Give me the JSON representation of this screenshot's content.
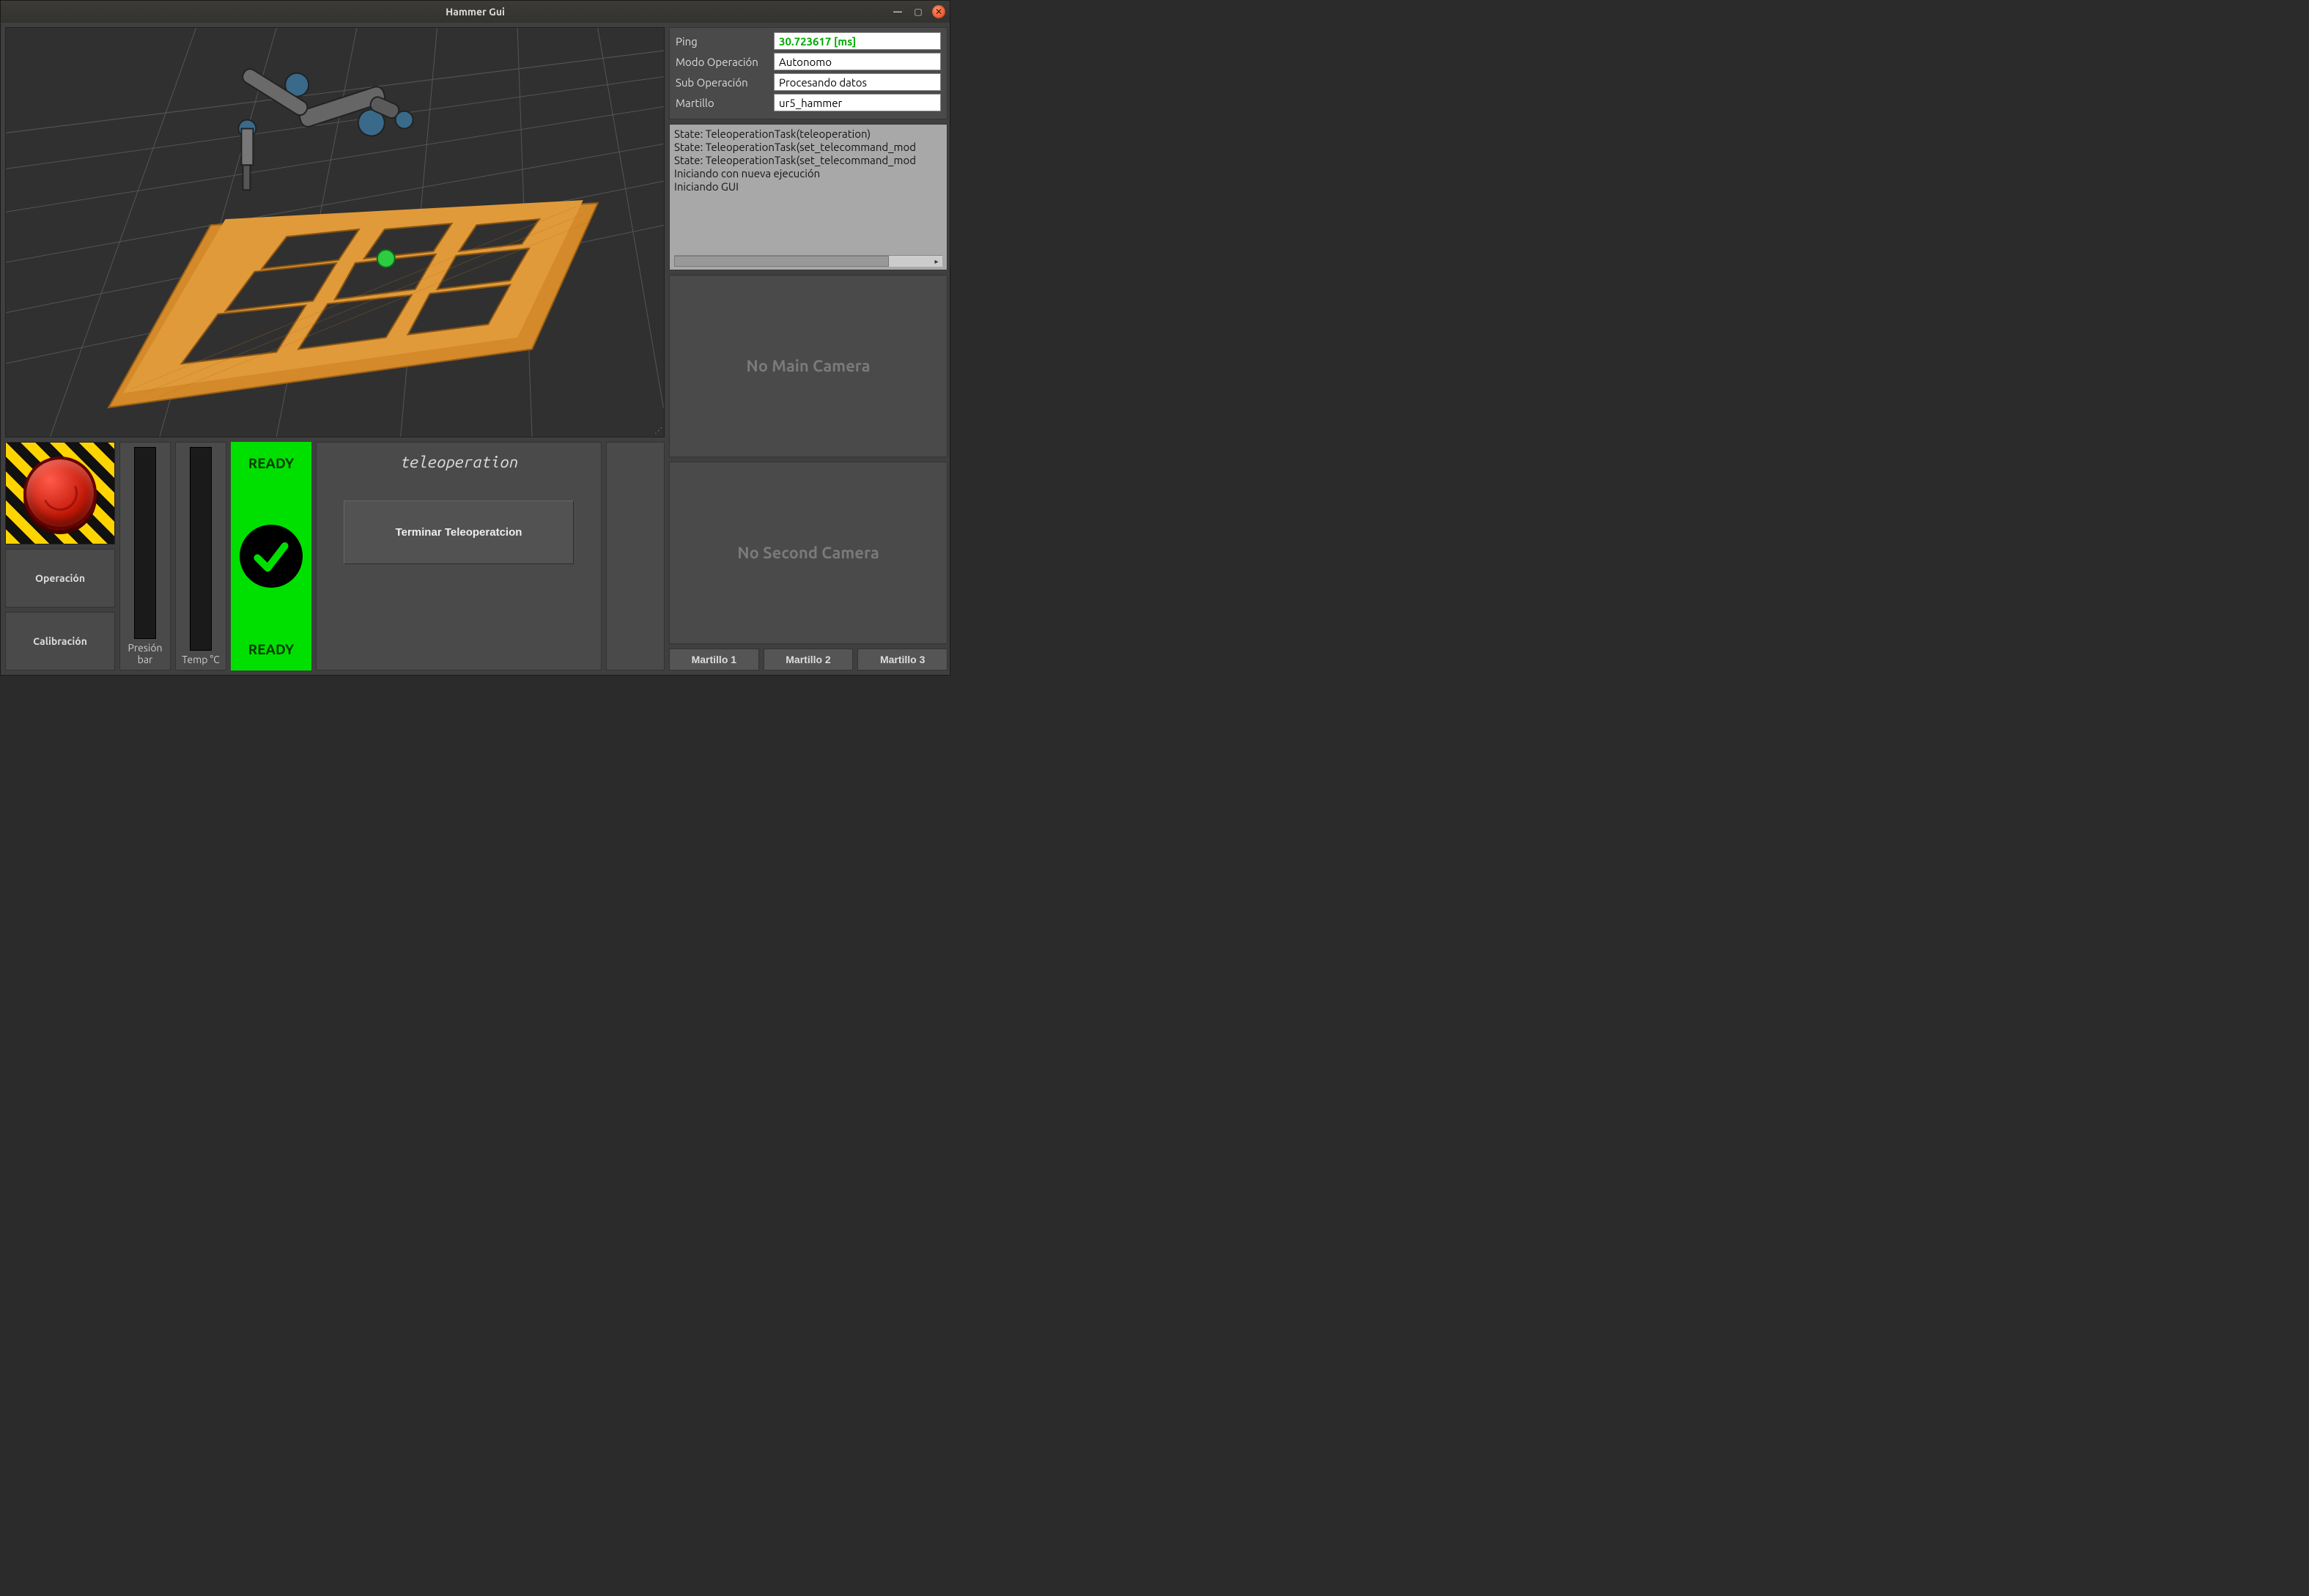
{
  "window": {
    "title": "Hammer Gui"
  },
  "status": {
    "ping_label": "Ping",
    "ping_value": "30.723617 [ms]",
    "mode_label": "Modo Operación",
    "mode_value": "Autonomo",
    "subop_label": "Sub Operación",
    "subop_value": "Procesando datos",
    "hammer_label": "Martillo",
    "hammer_value": "ur5_hammer"
  },
  "log": {
    "lines": "State: TeleoperationTask(teleoperation)\nState: TeleoperationTask(set_telecommand_mod\nState: TeleoperationTask(set_telecommand_mod\nIniciando con nueva ejecución\nIniciando GUI"
  },
  "cameras": {
    "main_placeholder": "No Main Camera",
    "second_placeholder": "No Second Camera"
  },
  "hammer_tabs": {
    "h1": "Martillo 1",
    "h2": "Martillo 2",
    "h3": "Martillo 3"
  },
  "side_buttons": {
    "operation": "Operación",
    "calibration": "Calibración"
  },
  "gauges": {
    "pressure_label": "Presión\nbar",
    "temp_label": "Temp\n°C"
  },
  "ready": {
    "top": "READY",
    "bottom": "READY"
  },
  "teleop": {
    "title": "teleoperation",
    "end_button": "Terminar Teleoperatcion"
  }
}
